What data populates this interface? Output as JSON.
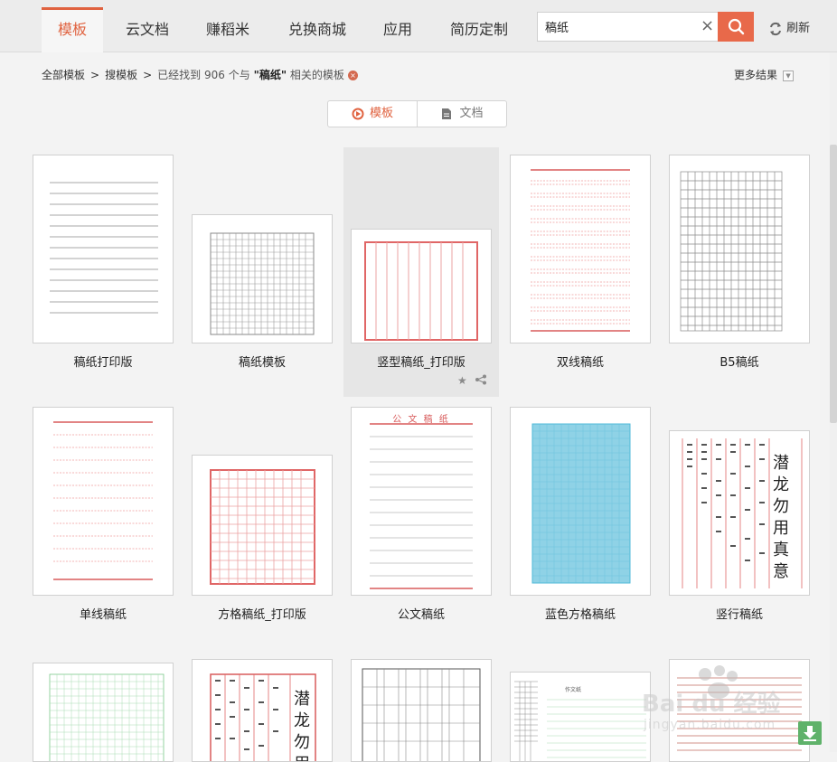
{
  "nav": {
    "tabs": [
      {
        "label": "模板",
        "active": true
      },
      {
        "label": "云文档",
        "active": false
      },
      {
        "label": "赚稻米",
        "active": false
      },
      {
        "label": "兑换商城",
        "active": false
      },
      {
        "label": "应用",
        "active": false
      },
      {
        "label": "简历定制",
        "active": false
      }
    ],
    "search_value": "稿纸",
    "refresh_label": "刷新"
  },
  "breadcrumb": {
    "root": "全部模板",
    "level2": "搜模板",
    "result_prefix": "已经找到",
    "count": "906",
    "result_mid": "个与",
    "keyword": "\"稿纸\"",
    "result_suffix": "相关的模板"
  },
  "more_results": "更多结果",
  "switcher": {
    "template_label": "模板",
    "doc_label": "文档"
  },
  "templates": [
    {
      "name": "稿纸打印版"
    },
    {
      "name": "稿纸模板"
    },
    {
      "name": "竖型稿纸_打印版"
    },
    {
      "name": "双线稿纸"
    },
    {
      "name": "B5稿纸"
    },
    {
      "name": "单线稿纸"
    },
    {
      "name": "方格稿纸_打印版"
    },
    {
      "name": "公文稿纸"
    },
    {
      "name": "蓝色方格稿纸"
    },
    {
      "name": "竖行稿纸"
    }
  ],
  "thumb_text": {
    "gongwen_title": "公 文 稿 纸",
    "vertical_poem": "潜龙勿用真意",
    "vertical_poem_2": "潜龙勿用",
    "small_header": "作文纸"
  },
  "watermark": {
    "brand": "Bai du 经验",
    "url": "jingyan.baidu.com"
  },
  "colors": {
    "accent": "#e0623f",
    "red_line": "#e06666",
    "blue_grid": "#4fb9d8"
  }
}
